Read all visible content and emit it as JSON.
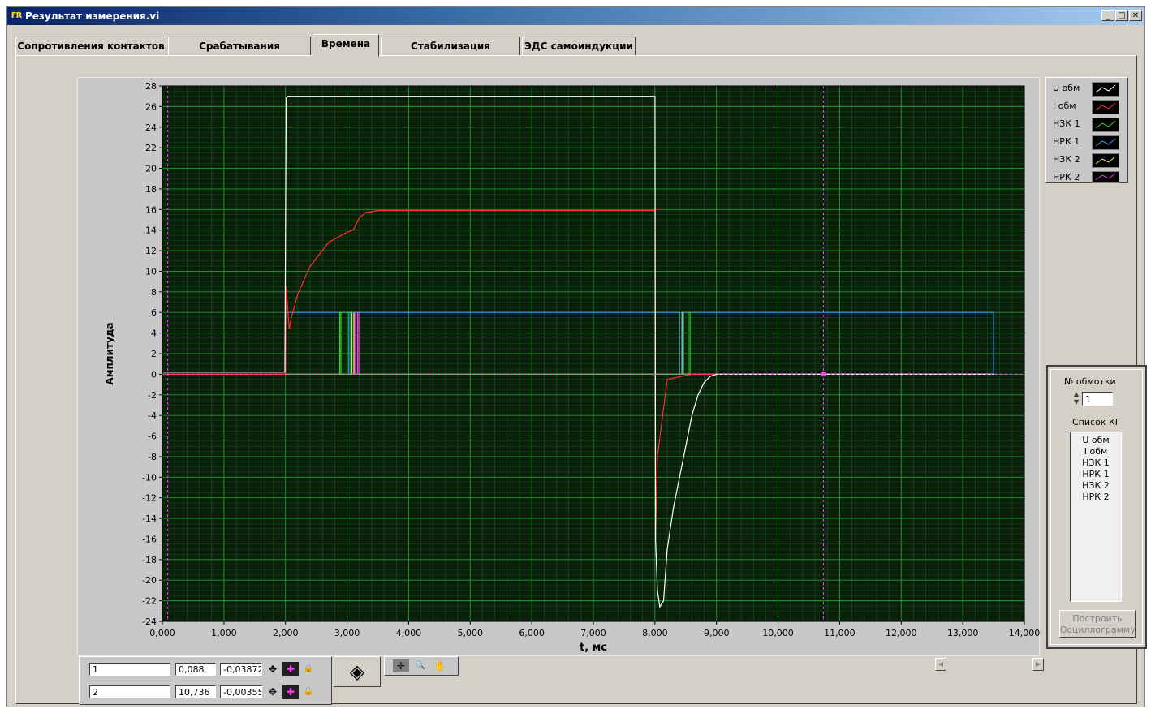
{
  "window": {
    "title": "Результат измерения.vi",
    "icon_text": "FR",
    "buttons": {
      "minimize": "_",
      "maximize": "□",
      "close": "✕"
    }
  },
  "tabs": [
    {
      "label": "Сопротивления контактов",
      "active": false
    },
    {
      "label": "Срабатывания отпускания",
      "active": false
    },
    {
      "label": "Времена",
      "active": true
    },
    {
      "label": "Стабилизация контактов",
      "active": false
    },
    {
      "label": "ЭДС самоиндукции",
      "active": false
    }
  ],
  "colors": {
    "plot_bg": "#0b200b",
    "grid_major": "#1e9a2e",
    "grid_minor": "#135a1c",
    "series": [
      "#ffffff",
      "#ff3030",
      "#30d030",
      "#20a0ff",
      "#d8e840",
      "#e040e0"
    ],
    "cursor": "#ff40ff"
  },
  "chart_data": {
    "type": "line",
    "xlabel": "t, мс",
    "ylabel": "Амплитуда",
    "xlim": [
      0,
      14000
    ],
    "ylim": [
      -24,
      28
    ],
    "x_ticks": [
      "0,000",
      "1,000",
      "2,000",
      "3,000",
      "4,000",
      "5,000",
      "6,000",
      "7,000",
      "8,000",
      "9,000",
      "10,000",
      "11,000",
      "12,000",
      "13,000",
      "14,000"
    ],
    "y_ticks": [
      "28",
      "26",
      "24",
      "22",
      "20",
      "18",
      "16",
      "14",
      "12",
      "10",
      "8",
      "6",
      "4",
      "2",
      "0",
      "-2",
      "-4",
      "-6",
      "-8",
      "-10",
      "-12",
      "-14",
      "-16",
      "-18",
      "-20",
      "-22",
      "-24"
    ],
    "grid": true,
    "legend_position": "right",
    "series": [
      {
        "name": "U обм",
        "x": [
          0,
          1990,
          2010,
          2040,
          8000,
          8010,
          8040,
          8080,
          8140,
          8200,
          8300,
          8400,
          8500,
          8600,
          8700,
          8800,
          8900,
          9000,
          13500
        ],
        "y": [
          0.2,
          0.2,
          26.8,
          27,
          27,
          -16,
          -21,
          -22.6,
          -22,
          -17,
          -13,
          -10,
          -7,
          -4,
          -2,
          -0.8,
          -0.2,
          0,
          0
        ]
      },
      {
        "name": "I обм",
        "x": [
          0,
          2000,
          2010,
          2060,
          2100,
          2200,
          2400,
          2700,
          3000,
          3100,
          3200,
          3300,
          3500,
          4000,
          8000,
          8010,
          8040,
          8200,
          8600,
          13500
        ],
        "y": [
          0,
          0,
          8.5,
          4.4,
          5.6,
          7.8,
          10.5,
          12.8,
          13.8,
          14,
          15.2,
          15.7,
          15.9,
          15.9,
          15.9,
          -16,
          -8,
          -0.5,
          0,
          0
        ]
      },
      {
        "name": "НЗК 1",
        "x": [
          0,
          2880,
          2880,
          2900,
          2900,
          3000,
          3000,
          3060,
          3060,
          8540,
          8540,
          8570,
          8570,
          13500
        ],
        "y": [
          0,
          0,
          6,
          6,
          0,
          0,
          6,
          6,
          0,
          0,
          6,
          6,
          0,
          0
        ]
      },
      {
        "name": "НРК 1",
        "x": [
          0,
          2000,
          2000,
          3000,
          3000,
          3030,
          3030,
          8400,
          8400,
          8450,
          8450,
          13500,
          13500
        ],
        "y": [
          0,
          0,
          6,
          6,
          0,
          0,
          6,
          6,
          0,
          0,
          6,
          6,
          0
        ]
      },
      {
        "name": "НЗК 2",
        "x": [
          0,
          3080,
          3080,
          3110,
          3110,
          8440,
          8440,
          8460,
          8460,
          13500
        ],
        "y": [
          0,
          0,
          6,
          6,
          0,
          0,
          6,
          6,
          0,
          0
        ]
      },
      {
        "name": "НРК 2",
        "x": [
          0,
          3120,
          3120,
          3140,
          3140,
          3170,
          3170,
          3190,
          3190,
          13500,
          13500
        ],
        "y": [
          0,
          0,
          6,
          6,
          0,
          0,
          6,
          6,
          0,
          0,
          0
        ]
      }
    ],
    "cursors": [
      {
        "x": 88
      },
      {
        "x": 10736
      }
    ]
  },
  "legend": [
    {
      "name": "U обм",
      "color": "#ffffff"
    },
    {
      "name": "I обм",
      "color": "#ff3030"
    },
    {
      "name": "НЗК 1",
      "color": "#30d030"
    },
    {
      "name": "НРК 1",
      "color": "#20a0ff"
    },
    {
      "name": "НЗК 2",
      "color": "#d8e840"
    },
    {
      "name": "НРК 2",
      "color": "#e040e0"
    }
  ],
  "controls": {
    "winding_label": "№ обмотки",
    "winding_value": "1",
    "list_label": "Список КГ",
    "list_items": [
      "U обм",
      "I обм",
      "НЗК 1",
      "НРК 1",
      "НЗК 2",
      "НРК 2"
    ],
    "build_button_line1": "Построить",
    "build_button_line2": "Осциллограмму"
  },
  "cursor_table": [
    {
      "name": "1",
      "x": "0,088",
      "y": "-0,03872"
    },
    {
      "name": "2",
      "x": "10,736",
      "y": "-0,00355"
    }
  ],
  "icons": {
    "cursor_move": "✥",
    "cursor_style": "✚",
    "cursor_lock": "🔒",
    "nav": "◈",
    "zoom_tool": "✛",
    "zoom_glass": "🔍",
    "pan_hand": "✋"
  }
}
